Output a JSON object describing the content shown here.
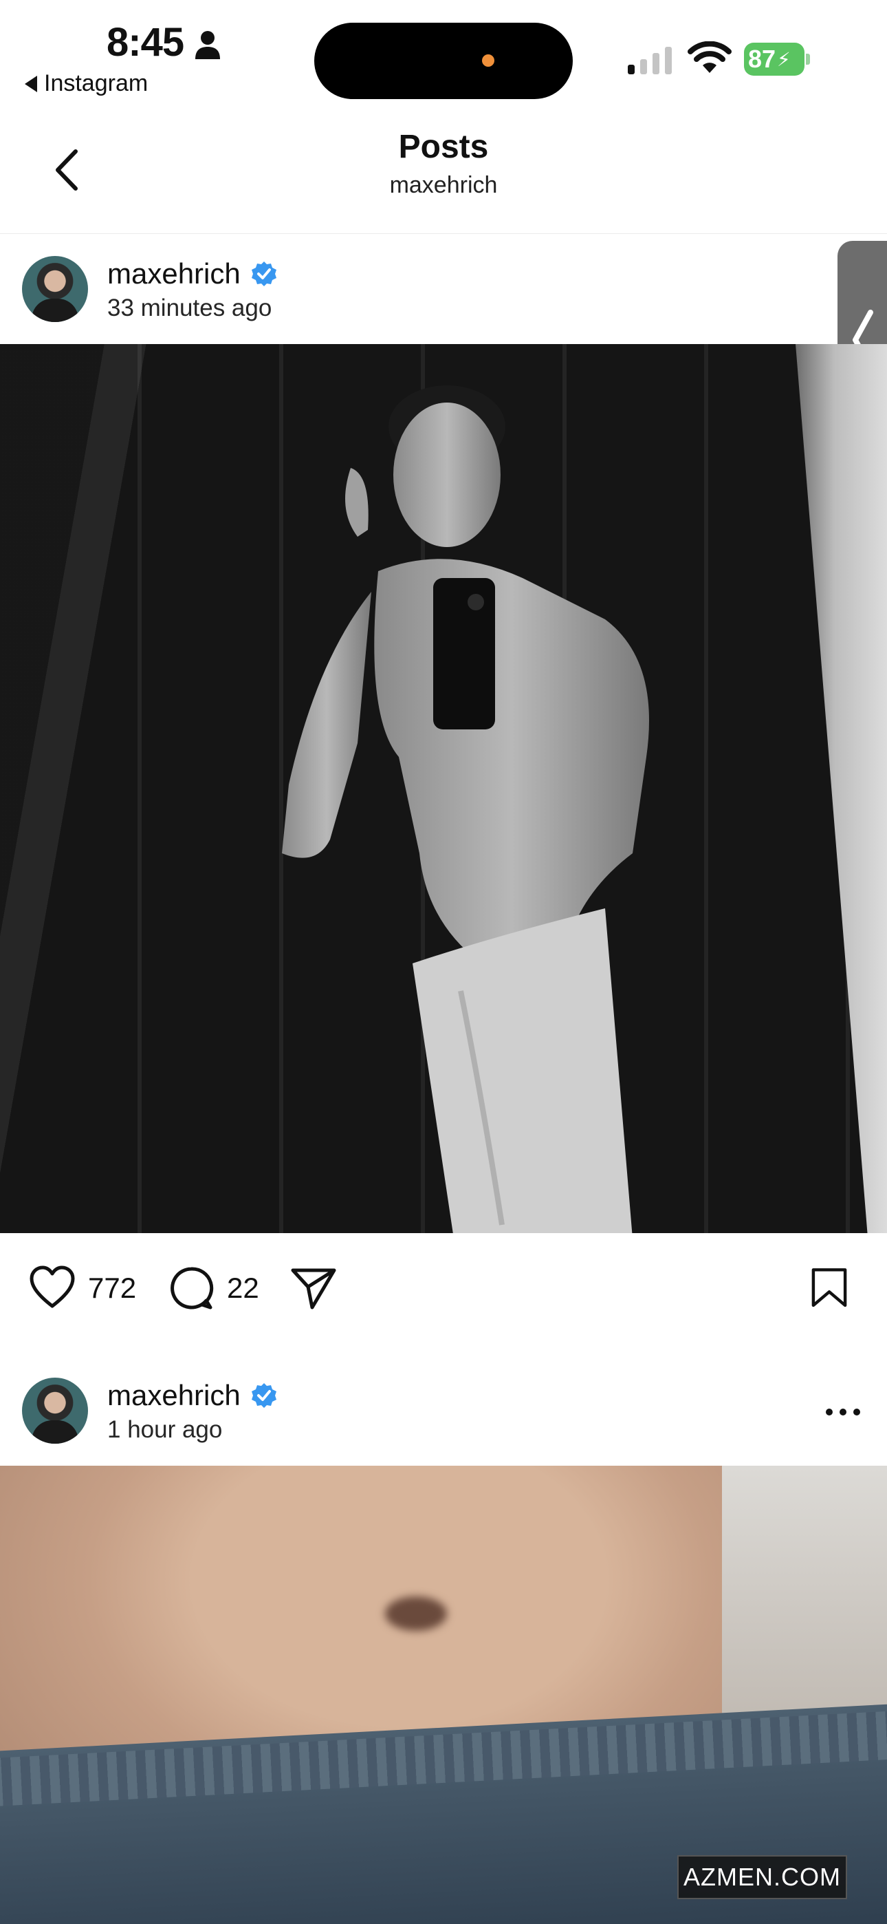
{
  "status_bar": {
    "time": "8:45",
    "back_app_label": "Instagram",
    "battery": "87"
  },
  "nav": {
    "title": "Posts",
    "subtitle": "maxehrich"
  },
  "posts": [
    {
      "username": "maxehrich",
      "time_ago": "33 minutes ago",
      "likes": "772",
      "comments": "22"
    },
    {
      "username": "maxehrich",
      "time_ago": "1 hour ago"
    }
  ],
  "watermark": "AZMEN.COM",
  "colors": {
    "verified": "#3897f0",
    "battery": "#5ac461",
    "island_dot": "#f0903a"
  }
}
